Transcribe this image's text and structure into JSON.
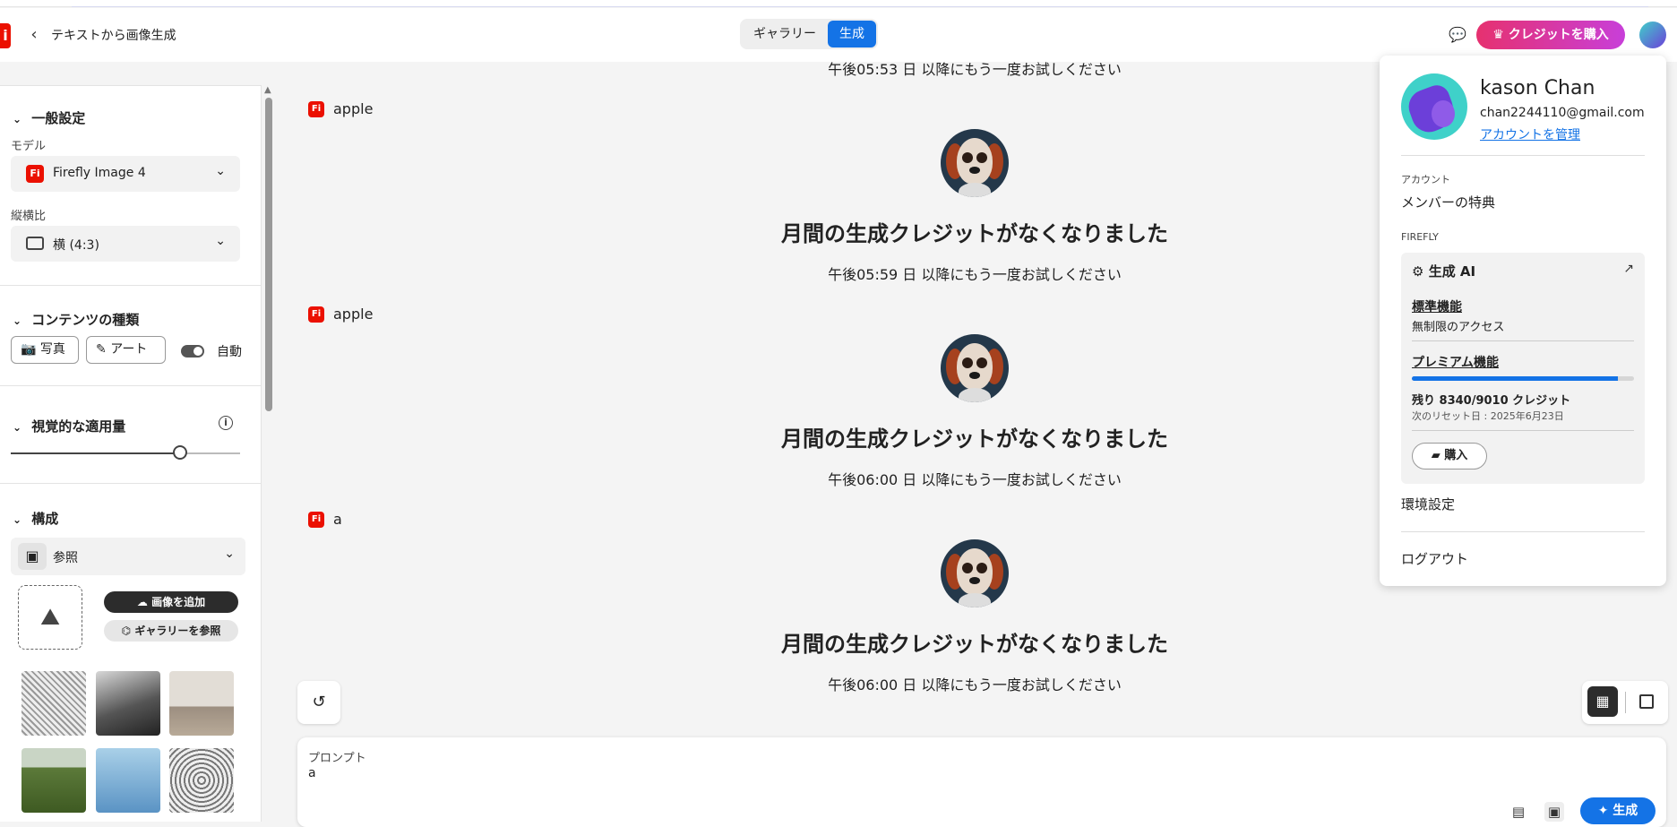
{
  "header": {
    "logo_text": "i",
    "back_glyph": "‹",
    "page_title": "テキストから画像生成",
    "tabs": [
      {
        "label": "ギャラリー",
        "active": false
      },
      {
        "label": "生成",
        "active": true
      }
    ],
    "chat_icon": "💬",
    "buy_credits": "♛ クレジットを購入"
  },
  "sidebar": {
    "general": {
      "title": "一般設定",
      "model_label": "モデル",
      "model_badge": "Fi",
      "model_value": "Firefly Image 4",
      "aspect_label": "縦横比",
      "aspect_value": "横 (4:3)"
    },
    "content_type": {
      "title": "コンテンツの種類",
      "photo": "写真",
      "art": "アート",
      "auto": "自動",
      "auto_on": true
    },
    "visual_intensity": {
      "title": "視覚的な適用量",
      "info": "i",
      "level": 0.72
    },
    "composition": {
      "title": "構成",
      "reference_label": "参照",
      "add_image": "画像を追加",
      "browse_gallery": "ギャラリーを参照"
    }
  },
  "chat": {
    "top_partial": "午後05:53 日 以降にもう一度お試しください",
    "messages": [
      {
        "badge": "Fi",
        "prompt": "apple",
        "heading": "月間の生成クレジットがなくなりました",
        "sub": "午後05:59 日 以降にもう一度お試しください"
      },
      {
        "badge": "Fi",
        "prompt": "apple",
        "heading": "月間の生成クレジットがなくなりました",
        "sub": "午後06:00 日 以降にもう一度お試しください"
      },
      {
        "badge": "Fi",
        "prompt": "a",
        "heading": "月間の生成クレジットがなくなりました",
        "sub": "午後06:00 日 以降にもう一度お試しください"
      }
    ]
  },
  "prompt": {
    "label": "プロンプト",
    "value": "a",
    "generate": "生成"
  },
  "profile": {
    "name": "kason Chan",
    "email": "chan2244110@gmail.com",
    "manage": "アカウントを管理",
    "account_section": "アカウント",
    "member_benefits": "メンバーの特典",
    "firefly_section": "FIREFLY",
    "gen_ai_title": "生成 AI",
    "standard_features": "標準機能",
    "unlimited_access": "無制限のアクセス",
    "premium_features": "プレミアム機能",
    "credits_remaining": "残り 8340/9010 クレジット",
    "credits_used_fraction": 0.926,
    "next_reset": "次のリセット日 : 2025年6月23日",
    "buy": "購入",
    "preferences": "環境設定",
    "logout": "ログアウト"
  },
  "colors": {
    "accent": "#1473e6",
    "brand": "#eb1000"
  }
}
